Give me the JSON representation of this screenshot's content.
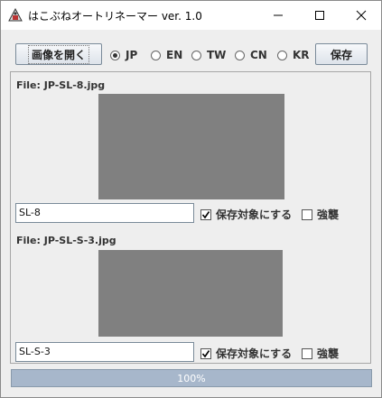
{
  "window": {
    "title": "はこぶねオートリネーマー ver. 1.0"
  },
  "toolbar": {
    "open_label": "画像を開く",
    "save_label": "保存",
    "languages": [
      {
        "label": "JP",
        "selected": true
      },
      {
        "label": "EN",
        "selected": false
      },
      {
        "label": "TW",
        "selected": false
      },
      {
        "label": "CN",
        "selected": false
      },
      {
        "label": "KR",
        "selected": false
      }
    ]
  },
  "files": [
    {
      "label": "File: JP-SL-8.jpg",
      "name_value": "SL-8",
      "save_label": "保存対象にする",
      "save_checked": true,
      "emphasis_label": "強襲",
      "emphasis_checked": false
    },
    {
      "label": "File: JP-SL-S-3.jpg",
      "name_value": "SL-S-3",
      "save_label": "保存対象にする",
      "save_checked": true,
      "emphasis_label": "強襲",
      "emphasis_checked": false
    }
  ],
  "progress": {
    "value": 1.0,
    "text": "100%"
  },
  "colors": {
    "preview": "#808080",
    "progress_fill": "#a7b7cb"
  }
}
